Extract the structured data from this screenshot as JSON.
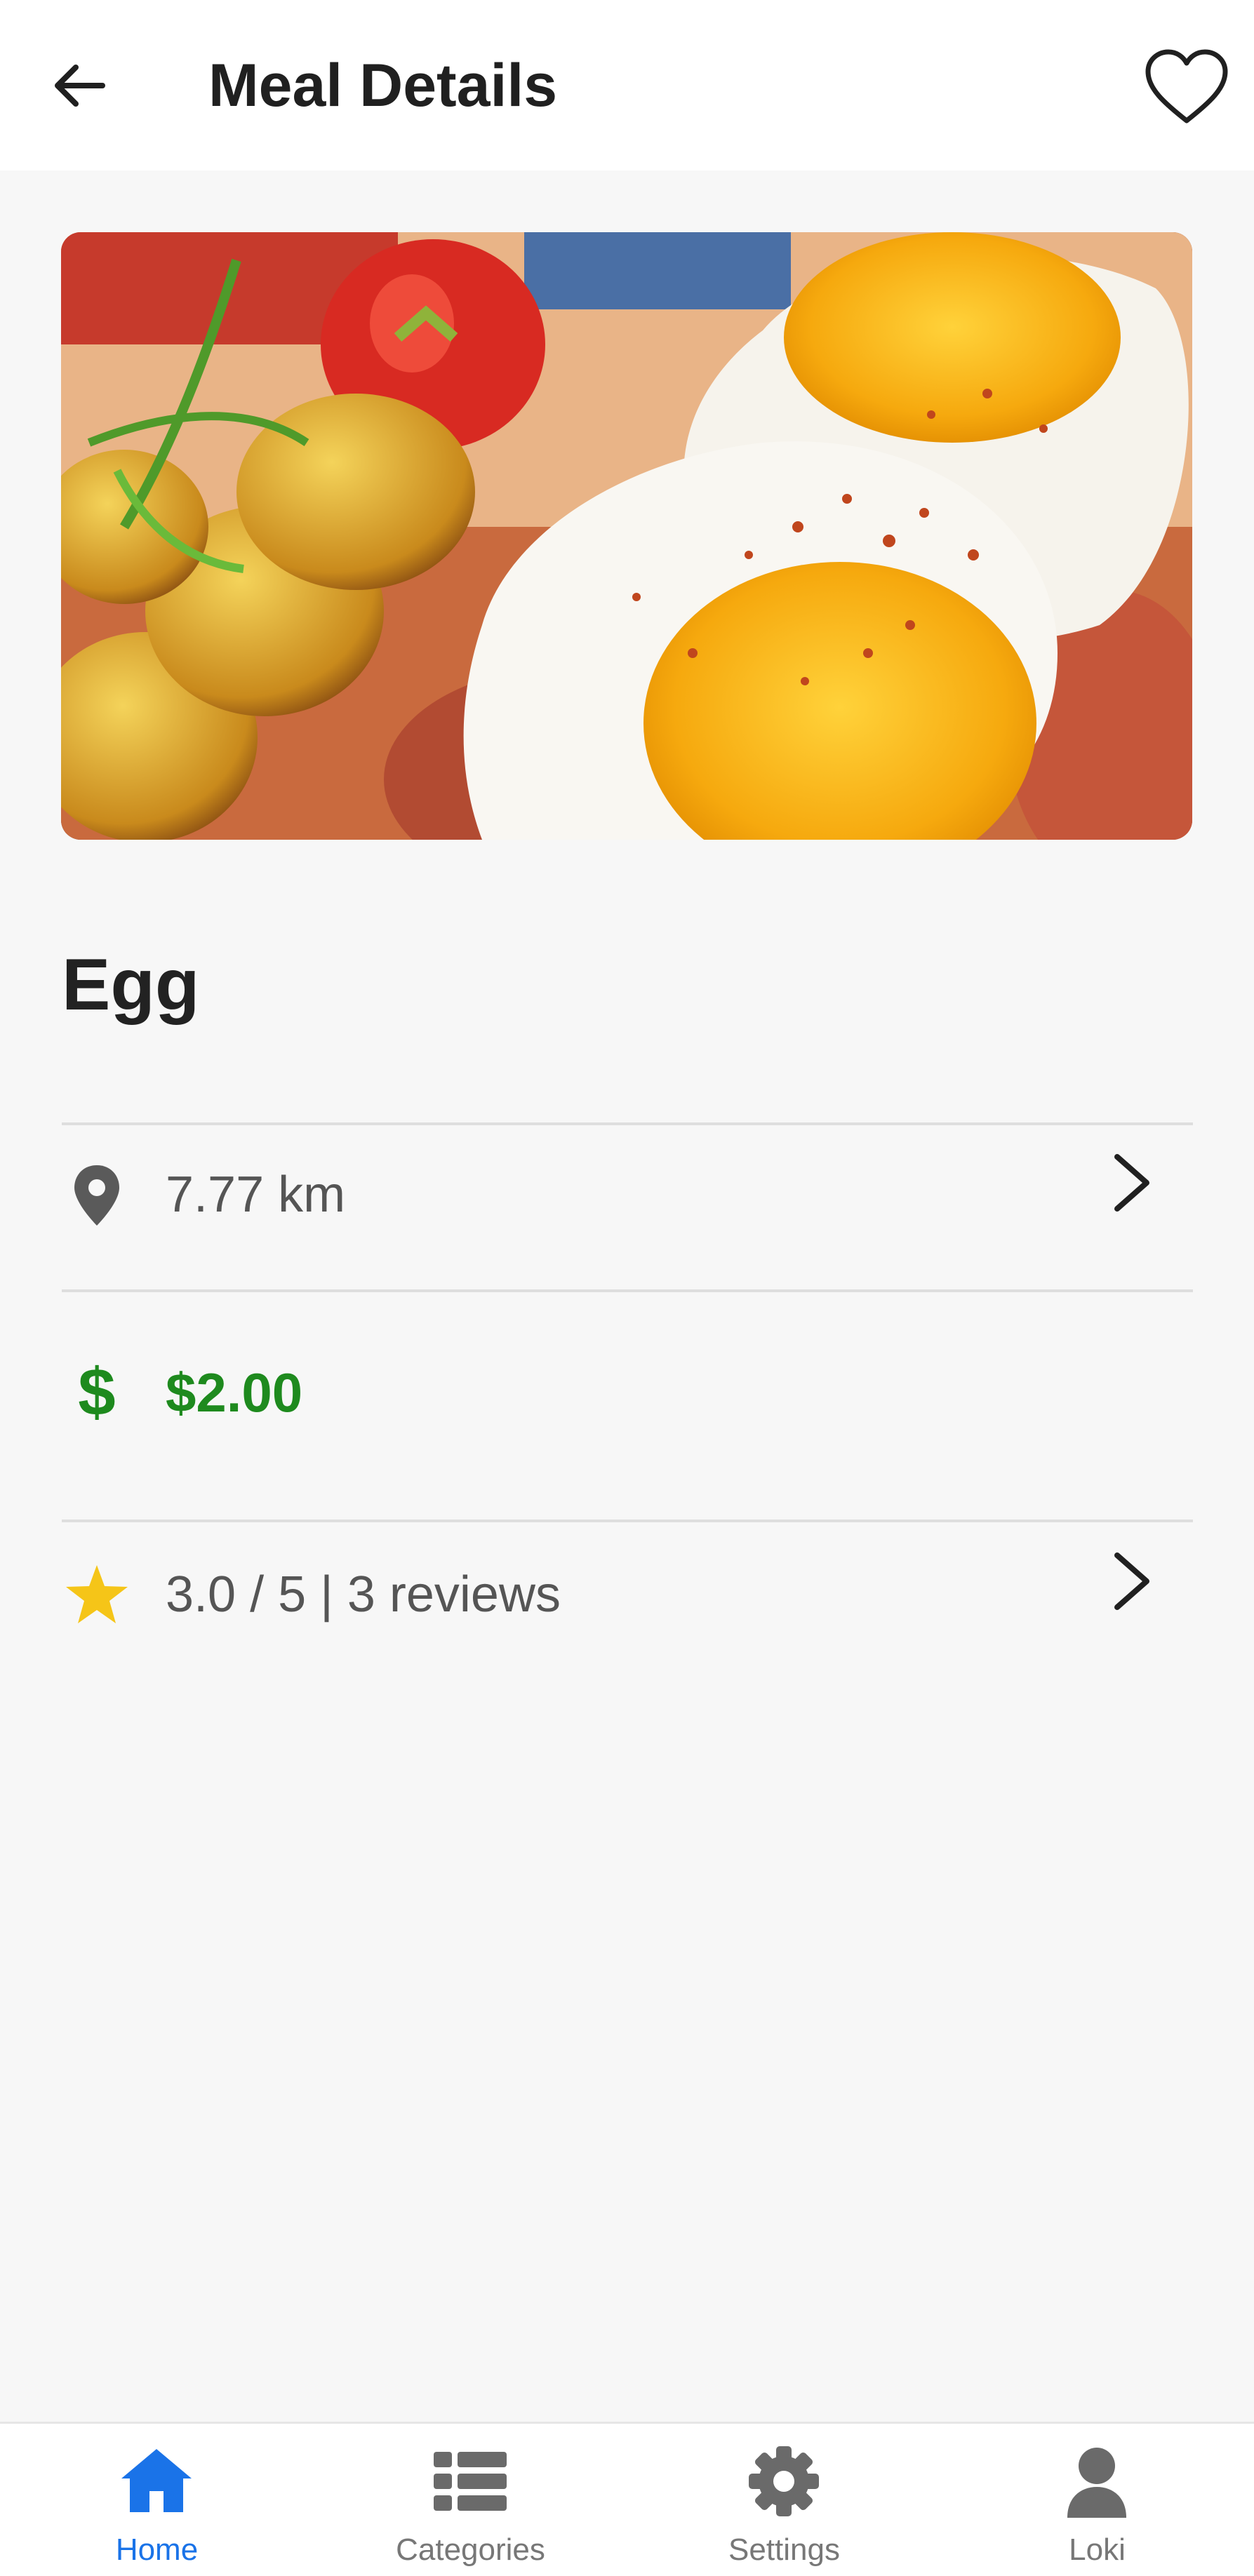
{
  "header": {
    "title": "Meal Details"
  },
  "meal": {
    "name": "Egg",
    "distance": "7.77 km",
    "price": "$2.00",
    "rating": "3.0 / 5 | 3 reviews"
  },
  "nav": {
    "items": [
      {
        "label": "Home",
        "icon": "home-icon",
        "active": true
      },
      {
        "label": "Categories",
        "icon": "list-icon",
        "active": false
      },
      {
        "label": "Settings",
        "icon": "gear-icon",
        "active": false
      },
      {
        "label": "Loki",
        "icon": "user-icon",
        "active": false
      }
    ]
  },
  "colors": {
    "accent": "#1a73e8",
    "price": "#1e8a1e",
    "star": "#f5c518",
    "text": "#222222",
    "muted": "#777777"
  }
}
